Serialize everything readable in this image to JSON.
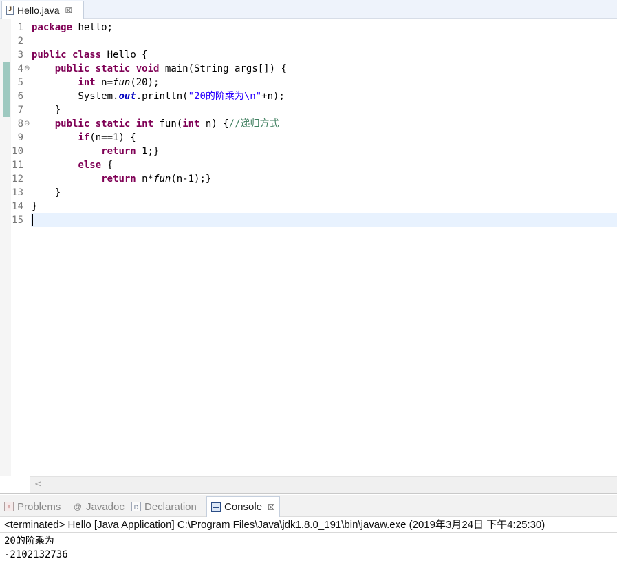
{
  "editor": {
    "tab": {
      "label": "Hello.java",
      "close_glyph": "☒",
      "icon": "java-file-icon"
    },
    "lines": [
      {
        "number": "1",
        "tokens": [
          {
            "t": "package",
            "c": "kw"
          },
          {
            "t": " hello;",
            "c": ""
          }
        ]
      },
      {
        "number": "2",
        "tokens": []
      },
      {
        "number": "3",
        "tokens": [
          {
            "t": "public",
            "c": "kw"
          },
          {
            "t": " ",
            "c": ""
          },
          {
            "t": "class",
            "c": "kw"
          },
          {
            "t": " Hello {",
            "c": ""
          }
        ]
      },
      {
        "number": "4",
        "fold": "⊖",
        "tokens": [
          {
            "t": "    ",
            "c": ""
          },
          {
            "t": "public",
            "c": "kw"
          },
          {
            "t": " ",
            "c": ""
          },
          {
            "t": "static",
            "c": "kw"
          },
          {
            "t": " ",
            "c": ""
          },
          {
            "t": "void",
            "c": "kw"
          },
          {
            "t": " main(String args[]) {",
            "c": ""
          }
        ]
      },
      {
        "number": "5",
        "tokens": [
          {
            "t": "        ",
            "c": ""
          },
          {
            "t": "int",
            "c": "kw"
          },
          {
            "t": " n=",
            "c": ""
          },
          {
            "t": "fun",
            "c": "static-call"
          },
          {
            "t": "(20);",
            "c": ""
          }
        ]
      },
      {
        "number": "6",
        "tokens": [
          {
            "t": "        System.",
            "c": ""
          },
          {
            "t": "out",
            "c": "field"
          },
          {
            "t": ".println(",
            "c": ""
          },
          {
            "t": "\"20的阶乘为\\n\"",
            "c": "str"
          },
          {
            "t": "+n);",
            "c": ""
          }
        ]
      },
      {
        "number": "7",
        "tokens": [
          {
            "t": "    }",
            "c": ""
          }
        ]
      },
      {
        "number": "8",
        "fold": "⊖",
        "tokens": [
          {
            "t": "    ",
            "c": ""
          },
          {
            "t": "public",
            "c": "kw"
          },
          {
            "t": " ",
            "c": ""
          },
          {
            "t": "static",
            "c": "kw"
          },
          {
            "t": " ",
            "c": ""
          },
          {
            "t": "int",
            "c": "kw"
          },
          {
            "t": " fun(",
            "c": ""
          },
          {
            "t": "int",
            "c": "kw"
          },
          {
            "t": " n) {",
            "c": ""
          },
          {
            "t": "//递归方式",
            "c": "cmt"
          }
        ]
      },
      {
        "number": "9",
        "tokens": [
          {
            "t": "        ",
            "c": ""
          },
          {
            "t": "if",
            "c": "kw"
          },
          {
            "t": "(n==1) {",
            "c": ""
          }
        ]
      },
      {
        "number": "10",
        "tokens": [
          {
            "t": "            ",
            "c": ""
          },
          {
            "t": "return",
            "c": "kw"
          },
          {
            "t": " 1;}",
            "c": ""
          }
        ]
      },
      {
        "number": "11",
        "tokens": [
          {
            "t": "        ",
            "c": ""
          },
          {
            "t": "else",
            "c": "kw"
          },
          {
            "t": " {",
            "c": ""
          }
        ]
      },
      {
        "number": "12",
        "tokens": [
          {
            "t": "            ",
            "c": ""
          },
          {
            "t": "return",
            "c": "kw"
          },
          {
            "t": " n*",
            "c": ""
          },
          {
            "t": "fun",
            "c": "static-call"
          },
          {
            "t": "(n-1);}",
            "c": ""
          }
        ]
      },
      {
        "number": "13",
        "tokens": [
          {
            "t": "    }",
            "c": ""
          }
        ]
      },
      {
        "number": "14",
        "tokens": [
          {
            "t": "}",
            "c": ""
          }
        ]
      },
      {
        "number": "15",
        "tokens": []
      }
    ],
    "changed_lines": [
      4,
      5,
      6,
      7
    ],
    "current_line": 15,
    "scroll_left_glyph": "<"
  },
  "panel": {
    "tabs": [
      {
        "label": "Problems",
        "icon": "problems-icon",
        "active": false
      },
      {
        "label": "Javadoc",
        "icon": "javadoc-icon",
        "glyph": "@",
        "active": false
      },
      {
        "label": "Declaration",
        "icon": "declaration-icon",
        "active": false
      },
      {
        "label": "Console",
        "icon": "console-icon",
        "active": true,
        "close_glyph": "☒"
      }
    ],
    "console": {
      "header": "<terminated> Hello [Java Application] C:\\Program Files\\Java\\jdk1.8.0_191\\bin\\javaw.exe (2019年3月24日 下午4:25:30)",
      "output": [
        "20的阶乘为",
        "-2102132736"
      ]
    }
  },
  "colors": {
    "keyword": "#7f0055",
    "string": "#2a00ff",
    "comment": "#3f7f5f",
    "field": "#0000c0",
    "current_line_bg": "#e8f2fe",
    "change_marker": "#9ec9c0"
  }
}
